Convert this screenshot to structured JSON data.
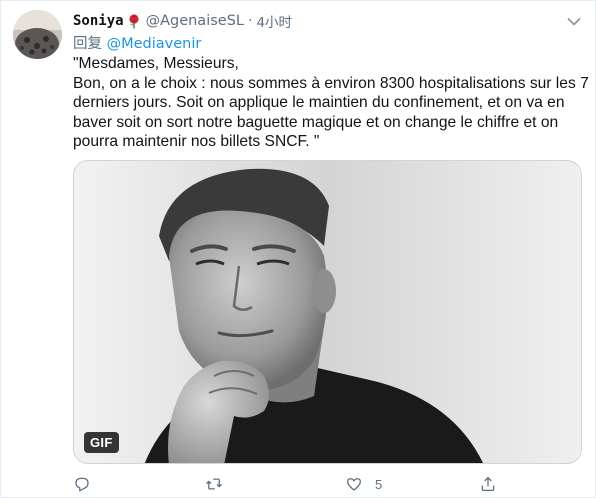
{
  "tweet": {
    "author": {
      "display_name": "Soniya",
      "handle": "@AgenaiseSL",
      "separator": "·",
      "time": "4小时",
      "badge_icon": "rose-icon"
    },
    "reply": {
      "prefix": "回复",
      "mention": "@Mediavenir"
    },
    "text_lines": [
      "\"Mesdames, Messieurs,",
      "Bon, on a le choix : nous sommes à environ 8300 hospitalisations sur les 7",
      "derniers jours. Soit on applique le maintien du confinement, et on va en",
      "baver soit on sort notre baguette magique et on change le chiffre et on",
      "pourra maintenir nos billets SNCF. \""
    ],
    "media": {
      "type": "gif",
      "badge": "GIF"
    },
    "actions": {
      "reply_count": "",
      "retweet_count": "",
      "like_count": "5",
      "share_label": ""
    },
    "colors": {
      "link": "#1b95e0",
      "secondary_text": "#5b7083",
      "primary_text": "#0f1419",
      "border": "#e6ecf0"
    }
  }
}
